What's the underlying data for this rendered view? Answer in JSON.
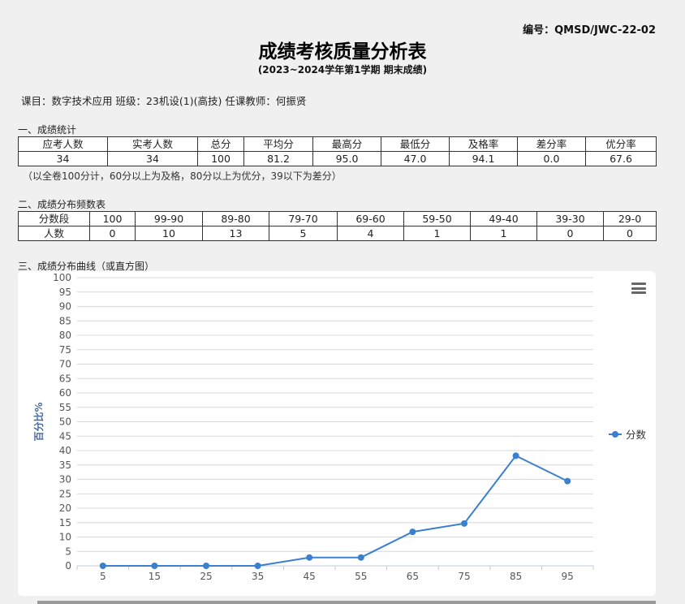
{
  "doc_code": "编号：QMSD/JWC-22-02",
  "title": "成绩考核质量分析表",
  "subtitle": "(2023~2024学年第1学期  期末成绩)",
  "course_line": "课目：数字技术应用 班级：23机设(1)(高技) 任课教师：何振贤",
  "section1": {
    "title": "一、成绩统计",
    "headers": [
      "应考人数",
      "实考人数",
      "总分",
      "平均分",
      "最高分",
      "最低分",
      "及格率",
      "差分率",
      "优分率"
    ],
    "values": [
      "34",
      "34",
      "100",
      "81.2",
      "95.0",
      "47.0",
      "94.1",
      "0.0",
      "67.6"
    ],
    "note": "（以全卷100分计，60分以上为及格，80分以上为优分，39以下为差分）"
  },
  "section2": {
    "title": "二、成绩分布频数表",
    "row1_label": "分数段",
    "row2_label": "人数",
    "bands": [
      "100",
      "99-90",
      "89-80",
      "79-70",
      "69-60",
      "59-50",
      "49-40",
      "39-30",
      "29-0"
    ],
    "counts": [
      "0",
      "10",
      "13",
      "5",
      "4",
      "1",
      "1",
      "0",
      "0"
    ]
  },
  "section3": {
    "title": "三、成绩分布曲线（或直方图）"
  },
  "chart_data": {
    "type": "line",
    "x": [
      5,
      15,
      25,
      35,
      45,
      55,
      65,
      75,
      85,
      95
    ],
    "series": [
      {
        "name": "分数",
        "values": [
          0,
          0,
          0,
          0,
          2.9,
          2.9,
          11.8,
          14.7,
          38.2,
          29.4
        ]
      }
    ],
    "ylabel": "百分比%",
    "ylim": [
      0,
      100
    ],
    "yticks": [
      0,
      5,
      10,
      15,
      20,
      25,
      30,
      35,
      40,
      45,
      50,
      55,
      60,
      65,
      70,
      75,
      80,
      85,
      90,
      95,
      100
    ],
    "grid": true,
    "legend": "right",
    "color": "#3a80d0"
  }
}
